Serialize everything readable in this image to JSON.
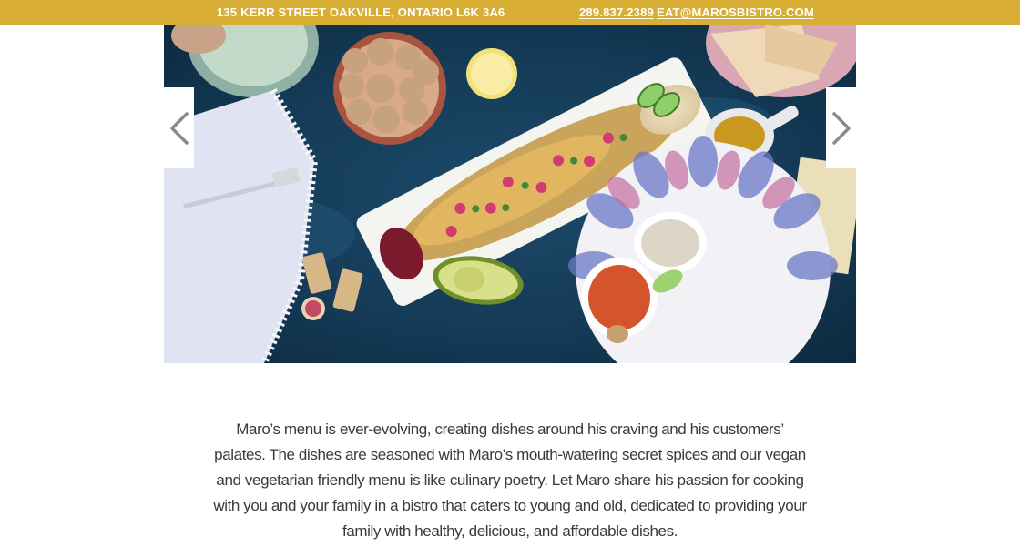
{
  "topbar": {
    "address": "135 KERR STREET OAKVILLE, ONTARIO L6K 3A6",
    "phone": "289.837.2389",
    "email": "EAT@MAROSBISTRO.COM",
    "background_color": "#d9ae34"
  },
  "slider": {
    "prev_icon": "chevron-left-icon",
    "next_icon": "chevron-right-icon"
  },
  "description": {
    "text": "Maro’s menu is ever-evolving, creating dishes around his craving and his customers’ palates. The dishes are seasoned with Maro’s mouth-watering secret spices and our vegan and vegetarian friendly menu is like culinary poetry. Let Maro share his passion for cooking with you and your family in a bistro that caters to young and old, dedicated to providing your family with healthy, delicious, and affordable dishes."
  }
}
